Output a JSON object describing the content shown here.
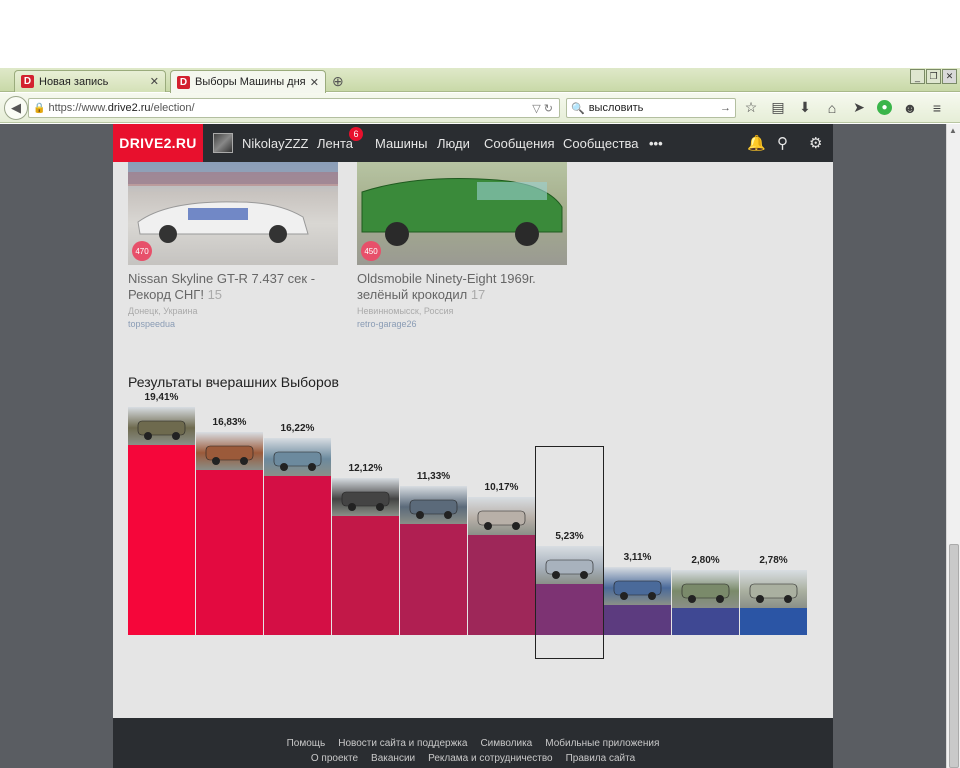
{
  "browser": {
    "tabs": [
      {
        "label": "Новая запись",
        "favicon": "D"
      },
      {
        "label": "Выборы Машины дня",
        "favicon": "D"
      }
    ],
    "url_prefix": "https://www.",
    "url_domain": "drive2.ru",
    "url_path": "/election/",
    "search_value": "высловить"
  },
  "site": {
    "logo": "DRIVE2.RU",
    "username": "NikolayZZZ",
    "nav": {
      "feed": "Лента",
      "feed_badge": "6",
      "cars": "Машины",
      "people": "Люди",
      "messages": "Сообщения",
      "communities": "Сообщества",
      "more": "•••"
    }
  },
  "cards": [
    {
      "count": "470",
      "title": "Nissan Skyline GT-R 7.437 сек - Рекорд СНГ!",
      "votes": "15",
      "location": "Донецк, Украина",
      "user": "topspeedua"
    },
    {
      "count": "450",
      "title": "Oldsmobile Ninety-Eight 1969г. зелёный крокодил",
      "votes": "17",
      "location": "Невинномысск, Россия",
      "user": "retro-garage26"
    }
  ],
  "results_title": "Результаты вчерашних Выборов",
  "chart_data": {
    "type": "bar",
    "categories": [
      "1",
      "2",
      "3",
      "4",
      "5",
      "6",
      "7",
      "8",
      "9",
      "10"
    ],
    "values": [
      19.41,
      16.83,
      16.22,
      12.12,
      11.33,
      10.17,
      5.23,
      3.11,
      2.8,
      2.78
    ],
    "labels": [
      "19,41%",
      "16,83%",
      "16,22%",
      "12,12%",
      "11,33%",
      "10,17%",
      "5,23%",
      "3,11%",
      "2,80%",
      "2,78%"
    ],
    "colors": [
      "#f5063a",
      "#e30a40",
      "#d40f45",
      "#c21848",
      "#b01f52",
      "#9e2759",
      "#7d3373",
      "#5c3b7f",
      "#3f4893",
      "#2b55a5"
    ],
    "selected_index": 6,
    "ylim": [
      0,
      19.41
    ]
  },
  "footer": {
    "row1": [
      "Помощь",
      "Новости сайта и поддержка",
      "Символика",
      "Мобильные приложения"
    ],
    "row2": [
      "О проекте",
      "Вакансии",
      "Реклама и сотрудничество",
      "Правила сайта"
    ]
  }
}
